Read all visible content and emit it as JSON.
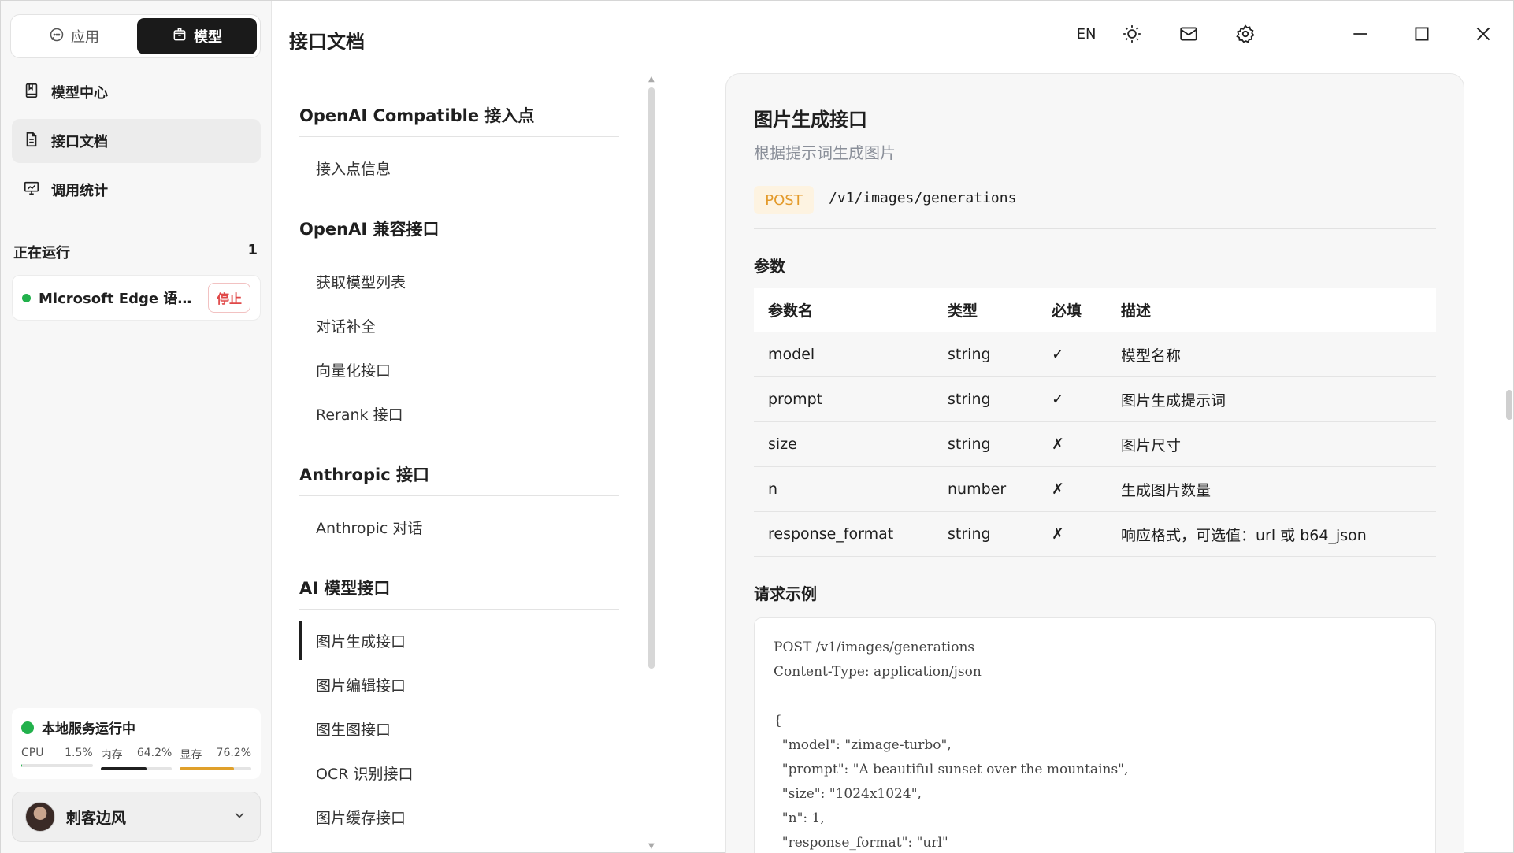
{
  "sidebar": {
    "segments": [
      {
        "label": "应用",
        "icon": "chat-bubble-icon",
        "active": false
      },
      {
        "label": "模型",
        "icon": "box-icon",
        "active": true
      }
    ],
    "nav": [
      {
        "label": "模型中心",
        "icon": "bookmark-book-icon",
        "active": false
      },
      {
        "label": "接口文档",
        "icon": "document-icon",
        "active": true
      },
      {
        "label": "调用统计",
        "icon": "presentation-chart-icon",
        "active": false
      }
    ],
    "running": {
      "title": "正在运行",
      "count": "1",
      "item_name": "Microsoft Edge 语音...",
      "stop_label": "停止",
      "status_color": "#22b14c"
    },
    "service": {
      "title": "本地服务运行中",
      "metrics": [
        {
          "label": "CPU",
          "value": "1.5%",
          "fraction": 0.015,
          "color": "#22b14c"
        },
        {
          "label": "内存",
          "value": "64.2%",
          "fraction": 0.642,
          "color": "#1f1f1f"
        },
        {
          "label": "显存",
          "value": "76.2%",
          "fraction": 0.762,
          "color": "#e0a02a"
        }
      ]
    },
    "user": {
      "name": "刺客边风"
    }
  },
  "header": {
    "title": "接口文档",
    "lang": "EN"
  },
  "toc": {
    "groups": [
      {
        "title": "OpenAI Compatible 接入点",
        "items": [
          "接入点信息"
        ]
      },
      {
        "title": "OpenAI 兼容接口",
        "items": [
          "获取模型列表",
          "对话补全",
          "向量化接口",
          "Rerank 接口"
        ]
      },
      {
        "title": "Anthropic 接口",
        "items": [
          "Anthropic 对话"
        ]
      },
      {
        "title": "AI 模型接口",
        "items": [
          "图片生成接口",
          "图片编辑接口",
          "图生图接口",
          "OCR 识别接口",
          "图片缓存接口"
        ]
      }
    ],
    "active_item": "图片生成接口"
  },
  "content": {
    "title": "图片生成接口",
    "subtitle": "根据提示词生成图片",
    "method": "POST",
    "endpoint": "/v1/images/generations",
    "params_label": "参数",
    "table": {
      "headers": [
        "参数名",
        "类型",
        "必填",
        "描述"
      ],
      "rows": [
        [
          "model",
          "string",
          "✓",
          "模型名称"
        ],
        [
          "prompt",
          "string",
          "✓",
          "图片生成提示词"
        ],
        [
          "size",
          "string",
          "✗",
          "图片尺寸"
        ],
        [
          "n",
          "number",
          "✗",
          "生成图片数量"
        ],
        [
          "response_format",
          "string",
          "✗",
          "响应格式，可选值：url 或 b64_json"
        ]
      ]
    },
    "request_label": "请求示例",
    "code_lines": [
      "POST /v1/images/generations",
      "Content-Type: application/json",
      "",
      "{",
      "  \"model\": \"zimage-turbo\",",
      "  \"prompt\": \"A beautiful sunset over the mountains\",",
      "  \"size\": \"1024x1024\",",
      "  \"n\": 1,",
      "  \"response_format\": \"url\""
    ]
  }
}
